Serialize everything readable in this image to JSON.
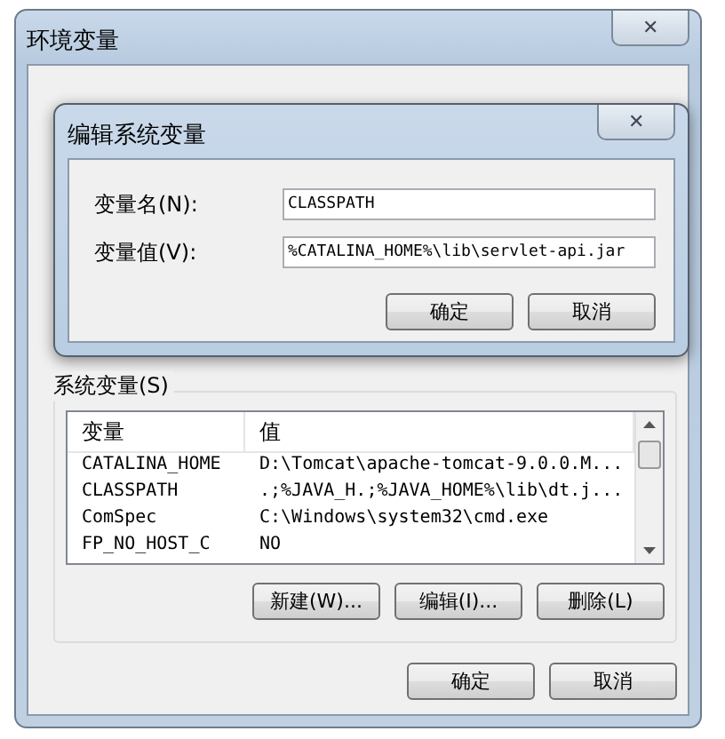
{
  "window": {
    "title": "环境变量",
    "close": "✕"
  },
  "system_variables": {
    "label": "系统变量(S)",
    "columns": [
      "变量",
      "值"
    ],
    "rows": [
      {
        "name": "CATALINA_HOME",
        "value": "D:\\Tomcat\\apache-tomcat-9.0.0.M...",
        "selected": false
      },
      {
        "name": "CLASSPATH",
        "value": ".;%JAVA_H.;%JAVA_HOME%\\lib\\dt.j...",
        "selected": false
      },
      {
        "name": "ComSpec",
        "value": "C:\\Windows\\system32\\cmd.exe",
        "selected": false
      },
      {
        "name": "FP_NO_HOST_C",
        "value": "NO",
        "selected": false
      }
    ],
    "buttons": [
      "新建(W)...",
      "编辑(I)...",
      "删除(L)"
    ]
  },
  "footer_buttons": [
    "确定",
    "取消"
  ],
  "dialog": {
    "title": "编辑系统变量",
    "close": "✕",
    "fields": [
      {
        "label": "变量名(N):",
        "value": "CLASSPATH"
      },
      {
        "label": "变量值(V):",
        "value": "%CATALINA_HOME%\\lib\\servlet-api.jar"
      }
    ],
    "buttons": [
      "确定",
      "取消"
    ]
  }
}
